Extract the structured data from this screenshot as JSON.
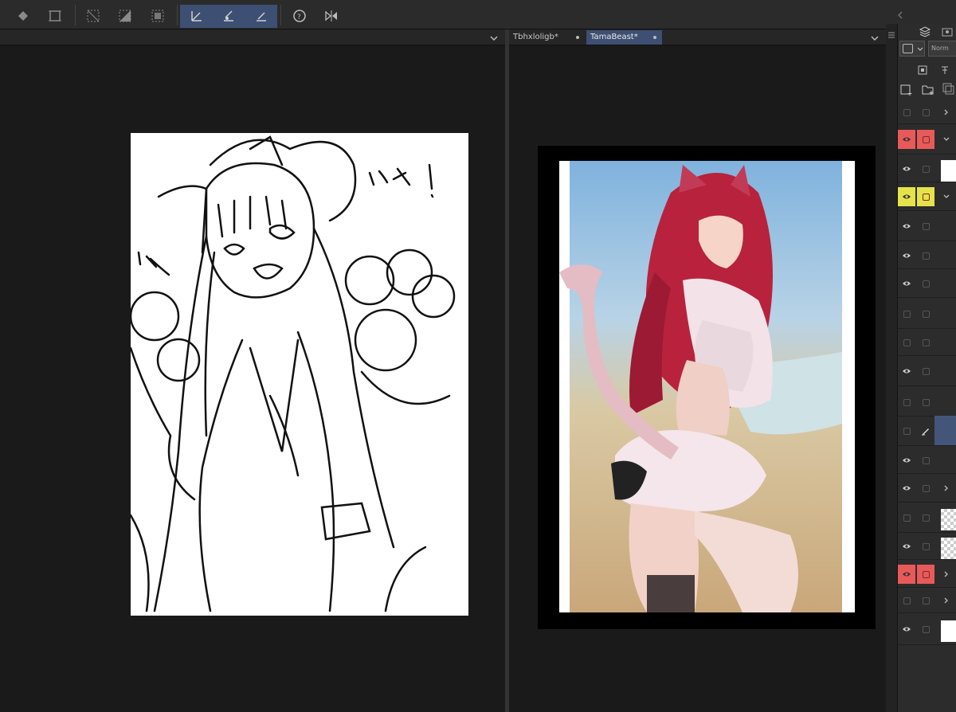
{
  "tabs": [
    {
      "label": "Tbhxloligb*"
    },
    {
      "label": "TamaBeast*"
    }
  ],
  "toolbar": {
    "tools": [
      "fill-icon",
      "transform-icon",
      "clear-selection-icon",
      "invert-selection-icon",
      "select-all-icon",
      "ruler-icon",
      "brush-ruler-icon",
      "guide-ruler-icon",
      "help-rotate-icon",
      "flip-horizontal-icon"
    ]
  },
  "layer_panel": {
    "blend_mode": "Norm",
    "rows": [
      {
        "visible": false,
        "color": "",
        "expand": "right"
      },
      {
        "visible": true,
        "color": "#e85a5a",
        "expand": "down"
      },
      {
        "visible": true,
        "color": "",
        "thumb": "white"
      },
      {
        "visible": true,
        "color": "#e6e24a",
        "expand": "down"
      },
      {
        "visible": true,
        "color": ""
      },
      {
        "visible": true,
        "color": ""
      },
      {
        "visible": true,
        "color": ""
      },
      {
        "visible": false,
        "color": ""
      },
      {
        "visible": false,
        "color": ""
      },
      {
        "visible": true,
        "color": ""
      },
      {
        "visible": false,
        "color": ""
      },
      {
        "visible": false,
        "color": "",
        "selected": true,
        "pen": true
      },
      {
        "visible": true,
        "color": ""
      },
      {
        "visible": true,
        "color": "",
        "expand": "right"
      },
      {
        "visible": false,
        "color": "",
        "thumb": "checker"
      },
      {
        "visible": true,
        "color": "",
        "thumb": "checker"
      },
      {
        "visible": true,
        "color": "#e85a5a",
        "expand": "right"
      },
      {
        "visible": false,
        "color": "",
        "expand": "right"
      },
      {
        "visible": true,
        "color": "",
        "thumb": "white"
      }
    ]
  },
  "colors": {
    "accent": "#3d4f72",
    "red_label": "#e85a5a",
    "yellow_label": "#e6e24a"
  }
}
